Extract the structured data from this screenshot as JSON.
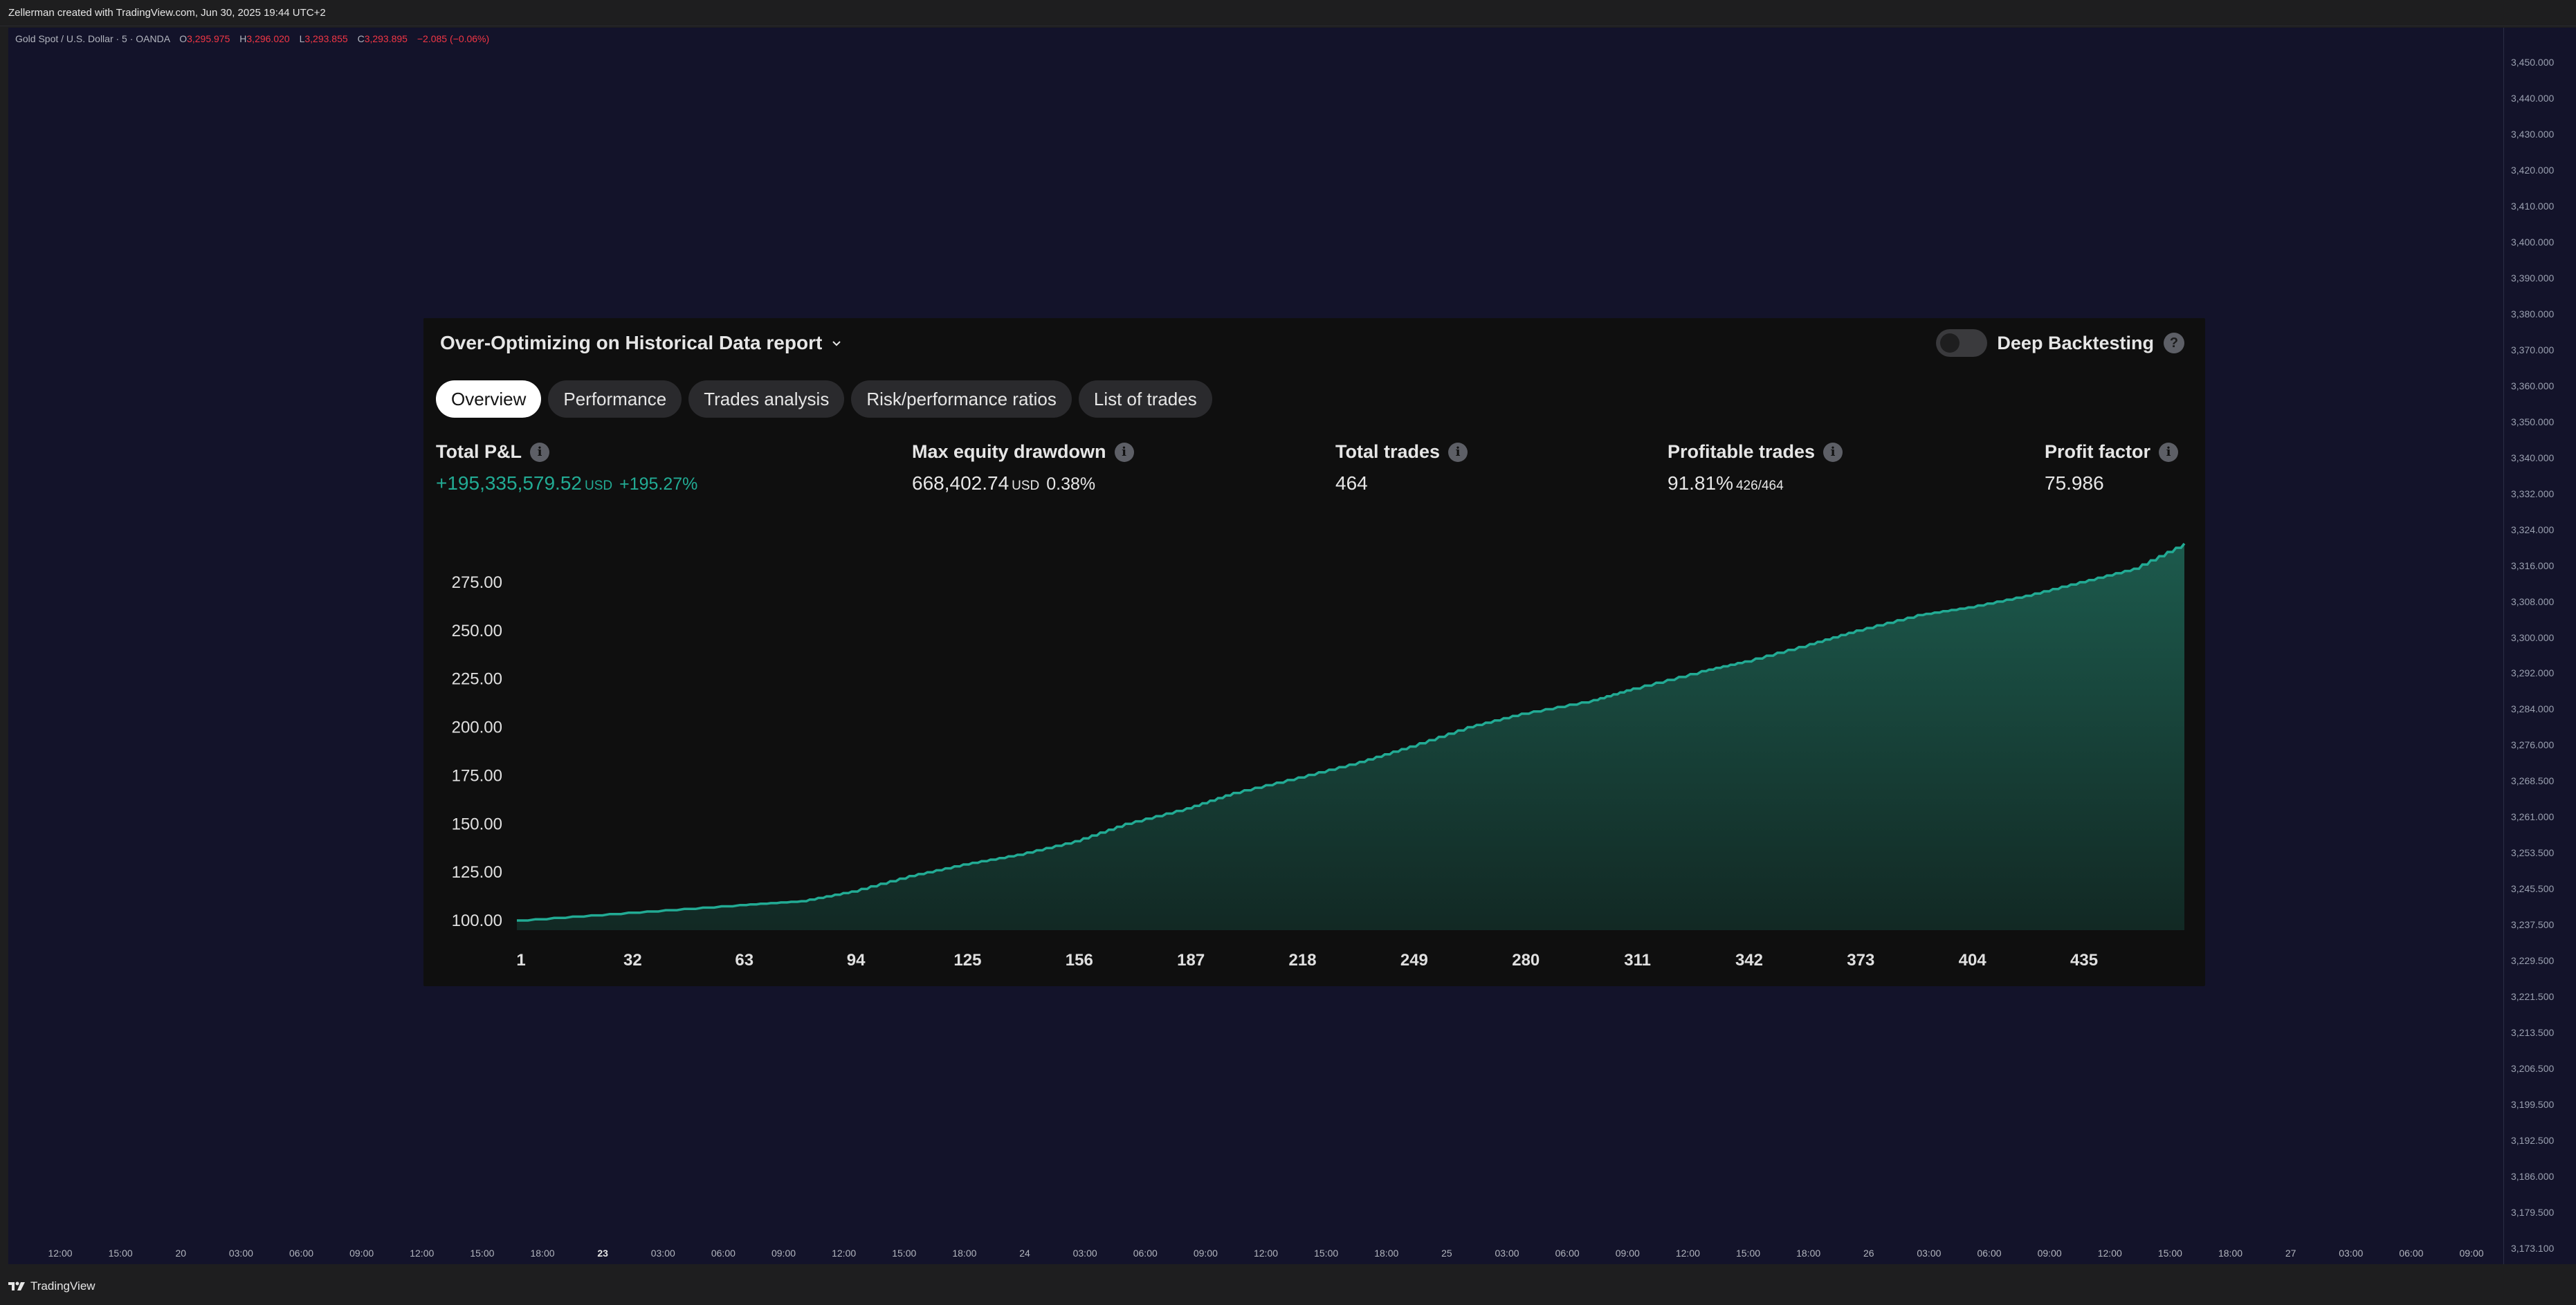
{
  "attribution": "Zellerman created with TradingView.com, Jun 30, 2025 19:44 UTC+2",
  "legend": {
    "symbol": "Gold Spot / U.S. Dollar · 5 · OANDA",
    "o_label": "O",
    "o_value": "3,295.975",
    "h_label": "H",
    "h_value": "3,296.020",
    "l_label": "L",
    "l_value": "3,293.855",
    "c_label": "C",
    "c_value": "3,293.895",
    "change": "−2.085 (−0.06%)"
  },
  "price_scale": [
    "3,450.000",
    "3,440.000",
    "3,430.000",
    "3,420.000",
    "3,410.000",
    "3,400.000",
    "3,390.000",
    "3,380.000",
    "3,370.000",
    "3,360.000",
    "3,350.000",
    "3,340.000",
    "3,332.000",
    "3,324.000",
    "3,316.000",
    "3,308.000",
    "3,300.000",
    "3,292.000",
    "3,284.000",
    "3,276.000",
    "3,268.500",
    "3,261.000",
    "3,253.500",
    "3,245.500",
    "3,237.500",
    "3,229.500",
    "3,221.500",
    "3,213.500",
    "3,206.500",
    "3,199.500",
    "3,192.500",
    "3,186.000",
    "3,179.500",
    "3,173.100"
  ],
  "time_axis": [
    {
      "t": "12:00"
    },
    {
      "t": "15:00"
    },
    {
      "t": "20"
    },
    {
      "t": "03:00"
    },
    {
      "t": "06:00"
    },
    {
      "t": "09:00"
    },
    {
      "t": "12:00"
    },
    {
      "t": "15:00"
    },
    {
      "t": "18:00"
    },
    {
      "t": "23",
      "bold": true
    },
    {
      "t": "03:00"
    },
    {
      "t": "06:00"
    },
    {
      "t": "09:00"
    },
    {
      "t": "12:00"
    },
    {
      "t": "15:00"
    },
    {
      "t": "18:00"
    },
    {
      "t": "24"
    },
    {
      "t": "03:00"
    },
    {
      "t": "06:00"
    },
    {
      "t": "09:00"
    },
    {
      "t": "12:00"
    },
    {
      "t": "15:00"
    },
    {
      "t": "18:00"
    },
    {
      "t": "25"
    },
    {
      "t": "03:00"
    },
    {
      "t": "06:00"
    },
    {
      "t": "09:00"
    },
    {
      "t": "12:00"
    },
    {
      "t": "15:00"
    },
    {
      "t": "18:00"
    },
    {
      "t": "26"
    },
    {
      "t": "03:00"
    },
    {
      "t": "06:00"
    },
    {
      "t": "09:00"
    },
    {
      "t": "12:00"
    },
    {
      "t": "15:00"
    },
    {
      "t": "18:00"
    },
    {
      "t": "27"
    },
    {
      "t": "03:00"
    },
    {
      "t": "06:00"
    },
    {
      "t": "09:00"
    }
  ],
  "footer": {
    "brand": "TradingView"
  },
  "report": {
    "title": "Over-Optimizing on Historical Data report",
    "deep_backtesting_label": "Deep Backtesting",
    "deep_backtesting_on": false,
    "help_glyph": "?",
    "info_glyph": "i",
    "tabs": [
      {
        "label": "Overview",
        "active": true
      },
      {
        "label": "Performance",
        "active": false
      },
      {
        "label": "Trades analysis",
        "active": false
      },
      {
        "label": "Risk/performance ratios",
        "active": false
      },
      {
        "label": "List of trades",
        "active": false
      }
    ],
    "metrics": {
      "total_pnl": {
        "label": "Total P&L",
        "value": "+195,335,579.52",
        "unit": "USD",
        "pct": "+195.27%"
      },
      "max_dd": {
        "label": "Max equity drawdown",
        "value": "668,402.74",
        "unit": "USD",
        "pct": "0.38%"
      },
      "total_trades": {
        "label": "Total trades",
        "value": "464"
      },
      "profitable": {
        "label": "Profitable trades",
        "value": "91.81%",
        "sub": "426/464"
      },
      "profit_factor": {
        "label": "Profit factor",
        "value": "75.986"
      }
    }
  },
  "chart_data": {
    "type": "area",
    "title": "",
    "xlabel": "",
    "ylabel": "",
    "x_ticks": [
      1,
      32,
      63,
      94,
      125,
      156,
      187,
      218,
      249,
      280,
      311,
      342,
      373,
      404,
      435
    ],
    "y_ticks": [
      100,
      125,
      150,
      175,
      200,
      225,
      250,
      275
    ],
    "xlim": [
      1,
      464
    ],
    "ylim": [
      95,
      290
    ],
    "grid": false,
    "color": "#22ab94",
    "series": [
      {
        "x": [
          1,
          32,
          63,
          80,
          94,
          110,
          125,
          140,
          156,
          170,
          187,
          200,
          218,
          235,
          249,
          265,
          280,
          300,
          311,
          330,
          342,
          360,
          373,
          390,
          404,
          420,
          435,
          450,
          464
        ],
        "values": [
          100,
          104,
          108,
          110,
          115,
          123,
          129,
          134,
          141,
          150,
          158,
          166,
          174,
          182,
          190,
          200,
          207,
          214,
          220,
          229,
          234,
          243,
          250,
          258,
          262,
          268,
          275,
          282,
          295
        ]
      }
    ]
  }
}
